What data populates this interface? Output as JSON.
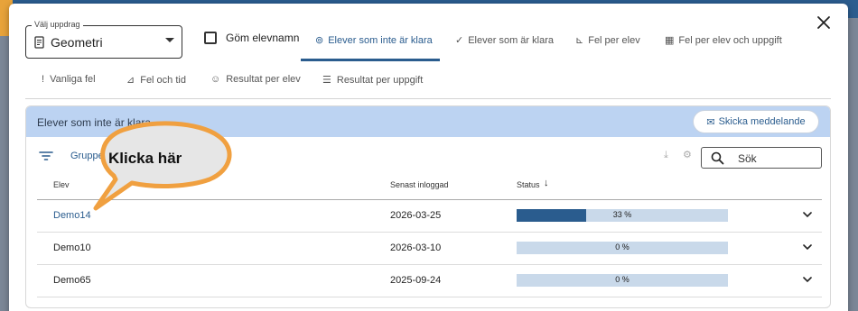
{
  "assignment_select": {
    "legend": "Välj uppdrag",
    "value": "Geometri",
    "icon": "document-icon"
  },
  "hide_names": {
    "label": "Göm elevnamn",
    "checked": false
  },
  "tabs": [
    {
      "label": "Elever som inte är klara",
      "icon": "binoculars-icon",
      "active": true
    },
    {
      "label": "Elever som är klara",
      "icon": "check-icon",
      "active": false
    },
    {
      "label": "Fel per elev",
      "icon": "chart-icon",
      "active": false
    },
    {
      "label": "Fel per elev och uppgift",
      "icon": "grid-icon",
      "active": false
    }
  ],
  "subtabs": [
    {
      "label": "Vanliga fel",
      "icon": "exclamation-icon"
    },
    {
      "label": "Fel och tid",
      "icon": "line-chart-icon"
    },
    {
      "label": "Resultat per elev",
      "icon": "person-icon"
    },
    {
      "label": "Resultat per uppgift",
      "icon": "list-icon"
    }
  ],
  "card": {
    "title": "Elever som inte är klara",
    "send_button": "Skicka meddelande",
    "groups_label": "Grupper",
    "search_placeholder": "Sök"
  },
  "table": {
    "columns": [
      "Elev",
      "Senast inloggad",
      "Status"
    ],
    "rows": [
      {
        "name": "Demo14",
        "last_login": "2026-03-25",
        "status_label": "33 %",
        "progress": 0.33,
        "link": true
      },
      {
        "name": "Demo10",
        "last_login": "2026-03-10",
        "status_label": "0 %",
        "progress": 0,
        "link": false
      },
      {
        "name": "Demo65",
        "last_login": "2025-09-24",
        "status_label": "0 %",
        "progress": 0,
        "link": false
      }
    ]
  },
  "callout": {
    "text": "Klicka här"
  },
  "colors": {
    "accent": "#2a5c8e",
    "header_bg": "#bcd3f2",
    "bar_bg": "#c9d9ea",
    "callout_border": "#f0a040",
    "callout_fill": "#e6e6e6"
  }
}
